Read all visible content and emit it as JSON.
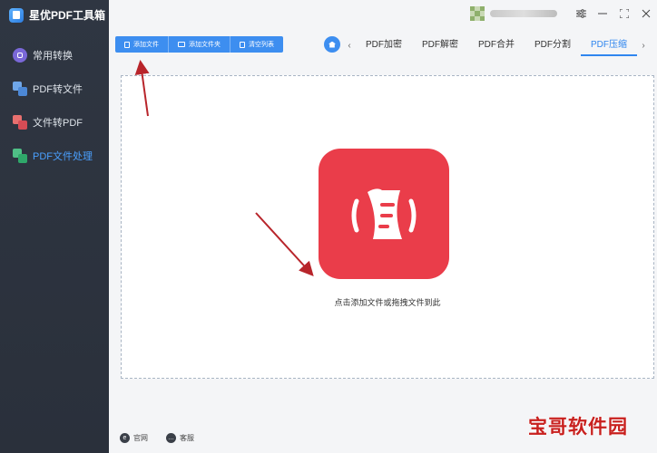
{
  "app": {
    "title": "星优PDF工具箱"
  },
  "sidebar": {
    "items": [
      {
        "label": "常用转换",
        "icon": "convert-icon"
      },
      {
        "label": "PDF转文件",
        "icon": "pdf-to-file-icon"
      },
      {
        "label": "文件转PDF",
        "icon": "file-to-pdf-icon"
      },
      {
        "label": "PDF文件处理",
        "icon": "pdf-process-icon",
        "active": true
      }
    ]
  },
  "footer": {
    "website": "官网",
    "service": "客服"
  },
  "toolbar": {
    "add_file": "添加文件",
    "add_folder": "添加文件夹",
    "clear_list": "清空列表"
  },
  "tabs": [
    {
      "label": "PDF加密"
    },
    {
      "label": "PDF解密"
    },
    {
      "label": "PDF合并"
    },
    {
      "label": "PDF分割"
    },
    {
      "label": "PDF压缩",
      "active": true
    }
  ],
  "dropzone": {
    "hint": "点击添加文件或拖拽文件到此"
  },
  "watermark": "宝哥软件园",
  "colors": {
    "accent": "#2f86ef",
    "sidebar_bg": "#2f3642",
    "drop_icon": "#ea3d4a",
    "annotation_arrow": "#b8252b"
  }
}
